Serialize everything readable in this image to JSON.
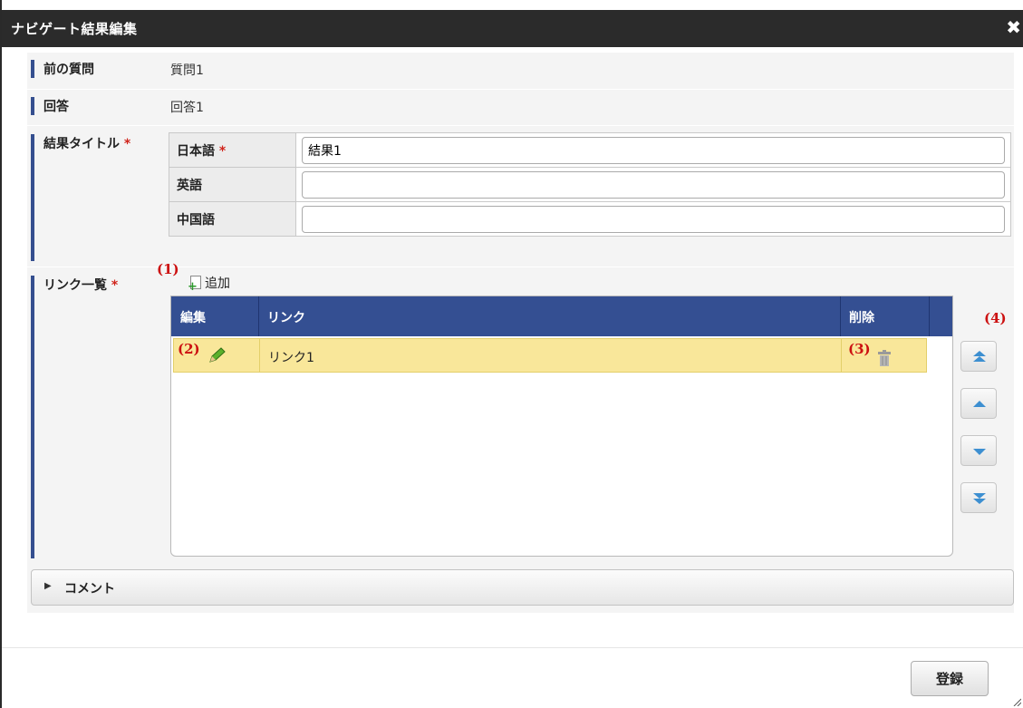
{
  "dialog": {
    "title": "ナビゲート結果編集",
    "close_glyph": "✖"
  },
  "form": {
    "previous_question": {
      "label": "前の質問",
      "value": "質問1"
    },
    "answer": {
      "label": "回答",
      "value": "回答1"
    },
    "result_title": {
      "label": "結果タイトル",
      "required_mark": "*",
      "languages": [
        {
          "label": "日本語",
          "required_mark": "*",
          "value": "結果1",
          "placeholder": ""
        },
        {
          "label": "英語",
          "required_mark": "",
          "value": "",
          "placeholder": ""
        },
        {
          "label": "中国語",
          "required_mark": "",
          "value": "",
          "placeholder": ""
        }
      ]
    },
    "link_list": {
      "label": "リンク一覧",
      "required_mark": "*",
      "add_label": "追加",
      "columns": [
        "編集",
        "リンク",
        "削除"
      ],
      "rows": [
        {
          "link": "リンク1"
        }
      ]
    },
    "comment_label": "コメント"
  },
  "annotations": [
    "(1)",
    "(2)",
    "(3)",
    "(4)"
  ],
  "footer": {
    "submit_label": "登録"
  },
  "icons": {
    "add": "add-document-icon",
    "edit": "pencil-icon",
    "delete": "trash-icon",
    "move_top": "double-chevron-up-icon",
    "move_up": "triangle-up-icon",
    "move_down": "triangle-down-icon",
    "move_bottom": "double-chevron-down-icon"
  },
  "colors": {
    "titlebar": "#2b2b2b",
    "accent": "#344f92",
    "selected_row": "#f9e79a",
    "required": "#d0241b",
    "annotation": "#cc1111",
    "arrow_button": "#3d8fd1"
  }
}
